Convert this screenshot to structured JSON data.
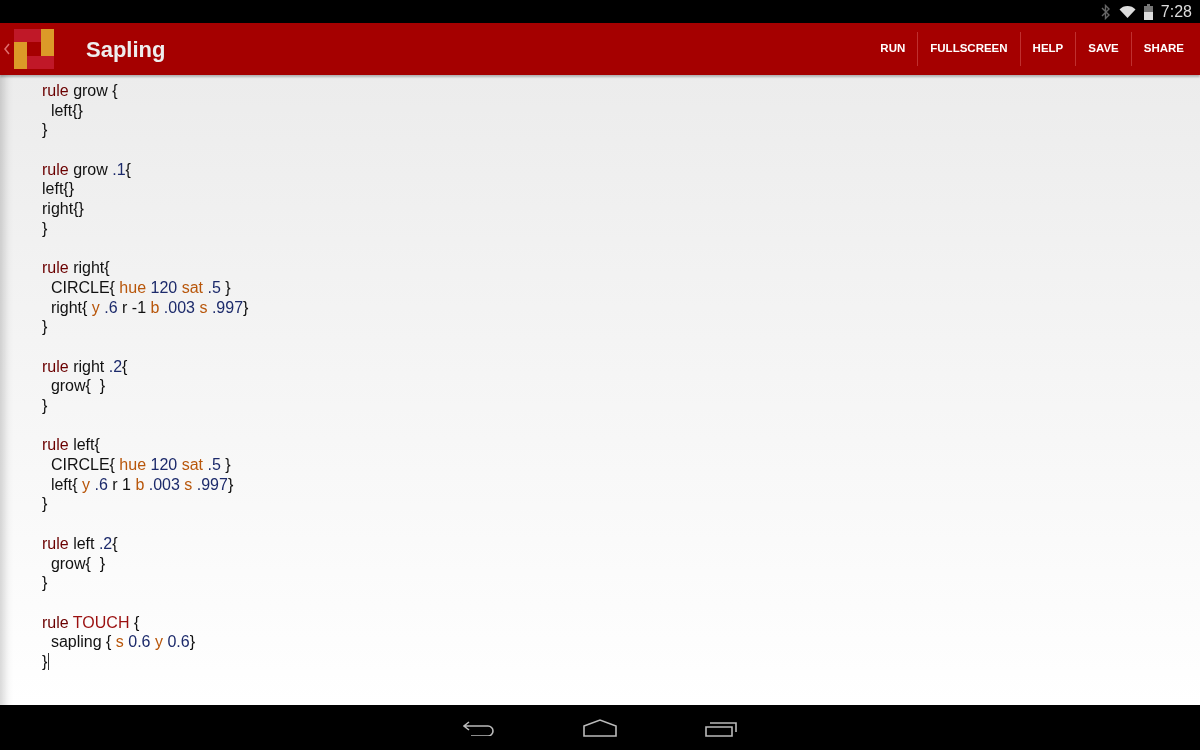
{
  "status_bar": {
    "time": "7:28"
  },
  "app_bar": {
    "title": "Sapling",
    "actions": [
      "RUN",
      "FULLSCREEN",
      "HELP",
      "SAVE",
      "SHARE"
    ]
  },
  "editor": {
    "blocks": [
      [
        {
          "segments": [
            {
              "kind": "keyword",
              "text": "rule"
            },
            {
              "kind": "plain",
              "text": " grow {"
            }
          ]
        },
        {
          "segments": [
            {
              "kind": "plain",
              "text": "  left{}"
            }
          ]
        },
        {
          "segments": [
            {
              "kind": "plain",
              "text": "}"
            }
          ]
        }
      ],
      [
        {
          "segments": [
            {
              "kind": "keyword",
              "text": "rule"
            },
            {
              "kind": "plain",
              "text": " grow "
            },
            {
              "kind": "number",
              "text": ".1"
            },
            {
              "kind": "plain",
              "text": "{"
            }
          ]
        },
        {
          "segments": [
            {
              "kind": "plain",
              "text": "left{}"
            }
          ]
        },
        {
          "segments": [
            {
              "kind": "plain",
              "text": "right{}"
            }
          ]
        },
        {
          "segments": [
            {
              "kind": "plain",
              "text": "}"
            }
          ]
        }
      ],
      [
        {
          "segments": [
            {
              "kind": "keyword",
              "text": "rule"
            },
            {
              "kind": "plain",
              "text": " right{"
            }
          ]
        },
        {
          "segments": [
            {
              "kind": "plain",
              "text": "  CIRCLE{ "
            },
            {
              "kind": "param",
              "text": "hue"
            },
            {
              "kind": "number",
              "text": " 120 "
            },
            {
              "kind": "param",
              "text": "sat"
            },
            {
              "kind": "number",
              "text": " .5 "
            },
            {
              "kind": "plain",
              "text": "}"
            }
          ]
        },
        {
          "segments": [
            {
              "kind": "plain",
              "text": "  right{ "
            },
            {
              "kind": "param",
              "text": "y"
            },
            {
              "kind": "number",
              "text": " .6 "
            },
            {
              "kind": "plain",
              "text": "r -1 "
            },
            {
              "kind": "param",
              "text": "b"
            },
            {
              "kind": "number",
              "text": " .003 "
            },
            {
              "kind": "param",
              "text": "s"
            },
            {
              "kind": "number",
              "text": " .997"
            },
            {
              "kind": "plain",
              "text": "}"
            }
          ]
        },
        {
          "segments": [
            {
              "kind": "plain",
              "text": "}"
            }
          ]
        }
      ],
      [
        {
          "segments": [
            {
              "kind": "keyword",
              "text": "rule"
            },
            {
              "kind": "plain",
              "text": " right "
            },
            {
              "kind": "number",
              "text": ".2"
            },
            {
              "kind": "plain",
              "text": "{"
            }
          ]
        },
        {
          "segments": [
            {
              "kind": "plain",
              "text": "  grow{  }"
            }
          ]
        },
        {
          "segments": [
            {
              "kind": "plain",
              "text": "}"
            }
          ]
        }
      ],
      [
        {
          "segments": [
            {
              "kind": "keyword",
              "text": "rule"
            },
            {
              "kind": "plain",
              "text": " left{"
            }
          ]
        },
        {
          "segments": [
            {
              "kind": "plain",
              "text": "  CIRCLE{ "
            },
            {
              "kind": "param",
              "text": "hue"
            },
            {
              "kind": "number",
              "text": " 120 "
            },
            {
              "kind": "param",
              "text": "sat"
            },
            {
              "kind": "number",
              "text": " .5 "
            },
            {
              "kind": "plain",
              "text": "}"
            }
          ]
        },
        {
          "segments": [
            {
              "kind": "plain",
              "text": "  left{ "
            },
            {
              "kind": "param",
              "text": "y"
            },
            {
              "kind": "number",
              "text": " .6 "
            },
            {
              "kind": "plain",
              "text": "r 1 "
            },
            {
              "kind": "param",
              "text": "b"
            },
            {
              "kind": "number",
              "text": " .003 "
            },
            {
              "kind": "param",
              "text": "s"
            },
            {
              "kind": "number",
              "text": " .997"
            },
            {
              "kind": "plain",
              "text": "}"
            }
          ]
        },
        {
          "segments": [
            {
              "kind": "plain",
              "text": "}"
            }
          ]
        }
      ],
      [
        {
          "segments": [
            {
              "kind": "keyword",
              "text": "rule"
            },
            {
              "kind": "plain",
              "text": " left "
            },
            {
              "kind": "number",
              "text": ".2"
            },
            {
              "kind": "plain",
              "text": "{"
            }
          ]
        },
        {
          "segments": [
            {
              "kind": "plain",
              "text": "  grow{  }"
            }
          ]
        },
        {
          "segments": [
            {
              "kind": "plain",
              "text": "}"
            }
          ]
        }
      ],
      [
        {
          "segments": [
            {
              "kind": "keyword",
              "text": "rule"
            },
            {
              "kind": "special",
              "text": " TOUCH"
            },
            {
              "kind": "plain",
              "text": " {"
            }
          ]
        },
        {
          "segments": [
            {
              "kind": "plain",
              "text": "  sapling { "
            },
            {
              "kind": "param",
              "text": "s"
            },
            {
              "kind": "number",
              "text": " 0.6 "
            },
            {
              "kind": "param",
              "text": "y"
            },
            {
              "kind": "number",
              "text": " 0.6"
            },
            {
              "kind": "plain",
              "text": "}"
            }
          ]
        },
        {
          "cursor": true,
          "segments": [
            {
              "kind": "plain",
              "text": "}"
            }
          ]
        }
      ]
    ]
  }
}
